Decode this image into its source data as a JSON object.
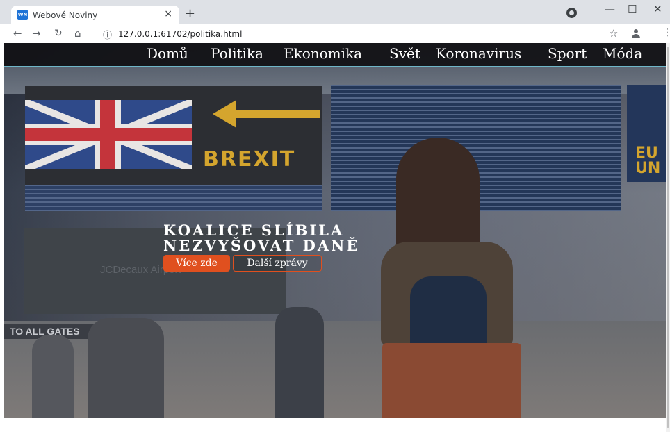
{
  "browser": {
    "tab_title": "Webové Noviny",
    "tab_favicon": "WN",
    "tab_close": "×",
    "new_tab": "+",
    "url": "127.0.0.1:61702/politika.html",
    "window_min": "—",
    "window_max": "☐",
    "window_close": "✕"
  },
  "site": {
    "nav": [
      "Domů",
      "Politika",
      "Ekonomika",
      "Svět",
      "Koronavirus",
      "Sport",
      "Móda"
    ],
    "headline_line1": "KOALICE SLÍBILA",
    "headline_line2": "NEZVYŠOVAT DANĚ",
    "primary_button": "Více zde",
    "secondary_button": "Další zprávy"
  },
  "hero_image": {
    "sign_text": "BREXIT",
    "sign_text_right": "EU\nUN",
    "billboard_text": "JCDecaux Airport",
    "gate_text": "TO ALL GATES"
  },
  "colors": {
    "accent": "#e0501f",
    "nav_bg": "#121216",
    "nav_border": "#6fb6c8"
  }
}
